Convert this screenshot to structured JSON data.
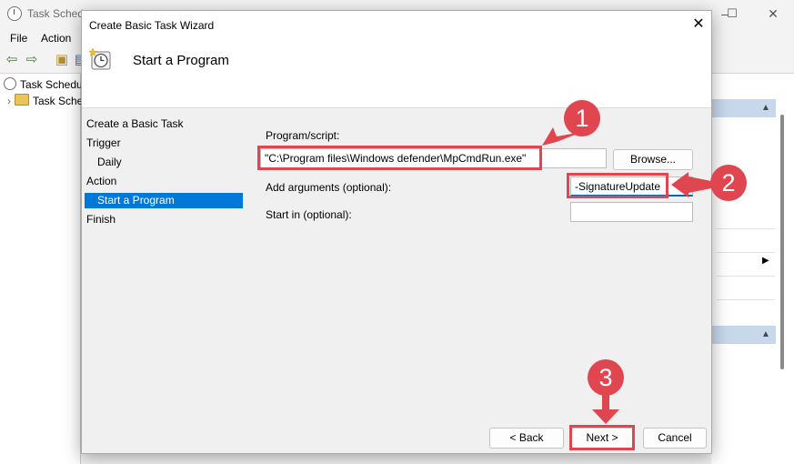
{
  "background_window": {
    "title": "Task Schedu",
    "menu": [
      "File",
      "Action"
    ],
    "tree": [
      {
        "label": "Task Schedule",
        "icon": "clock-icon"
      },
      {
        "label": "Task Sche",
        "icon": "folder-icon"
      }
    ]
  },
  "dialog": {
    "title": "Create Basic Task Wizard",
    "header_title": "Start a Program",
    "steps": [
      {
        "label": "Create a Basic Task",
        "selected": false
      },
      {
        "label": "Trigger",
        "selected": false
      },
      {
        "label": "Daily",
        "selected": false
      },
      {
        "label": "Action",
        "selected": false
      },
      {
        "label": "Start a Program",
        "selected": true
      },
      {
        "label": "Finish",
        "selected": false
      }
    ],
    "form": {
      "program_label": "Program/script:",
      "program_value": "\"C:\\Program files\\Windows defender\\MpCmdRun.exe\"",
      "browse_label": "Browse...",
      "arguments_label": "Add arguments (optional):",
      "arguments_value": "-SignatureUpdate",
      "start_in_label": "Start in (optional):",
      "start_in_value": ""
    },
    "buttons": {
      "back": "< Back",
      "next": "Next >",
      "cancel": "Cancel"
    }
  },
  "annotations": {
    "callouts": [
      "1",
      "2",
      "3"
    ],
    "color": "#e0464f"
  }
}
